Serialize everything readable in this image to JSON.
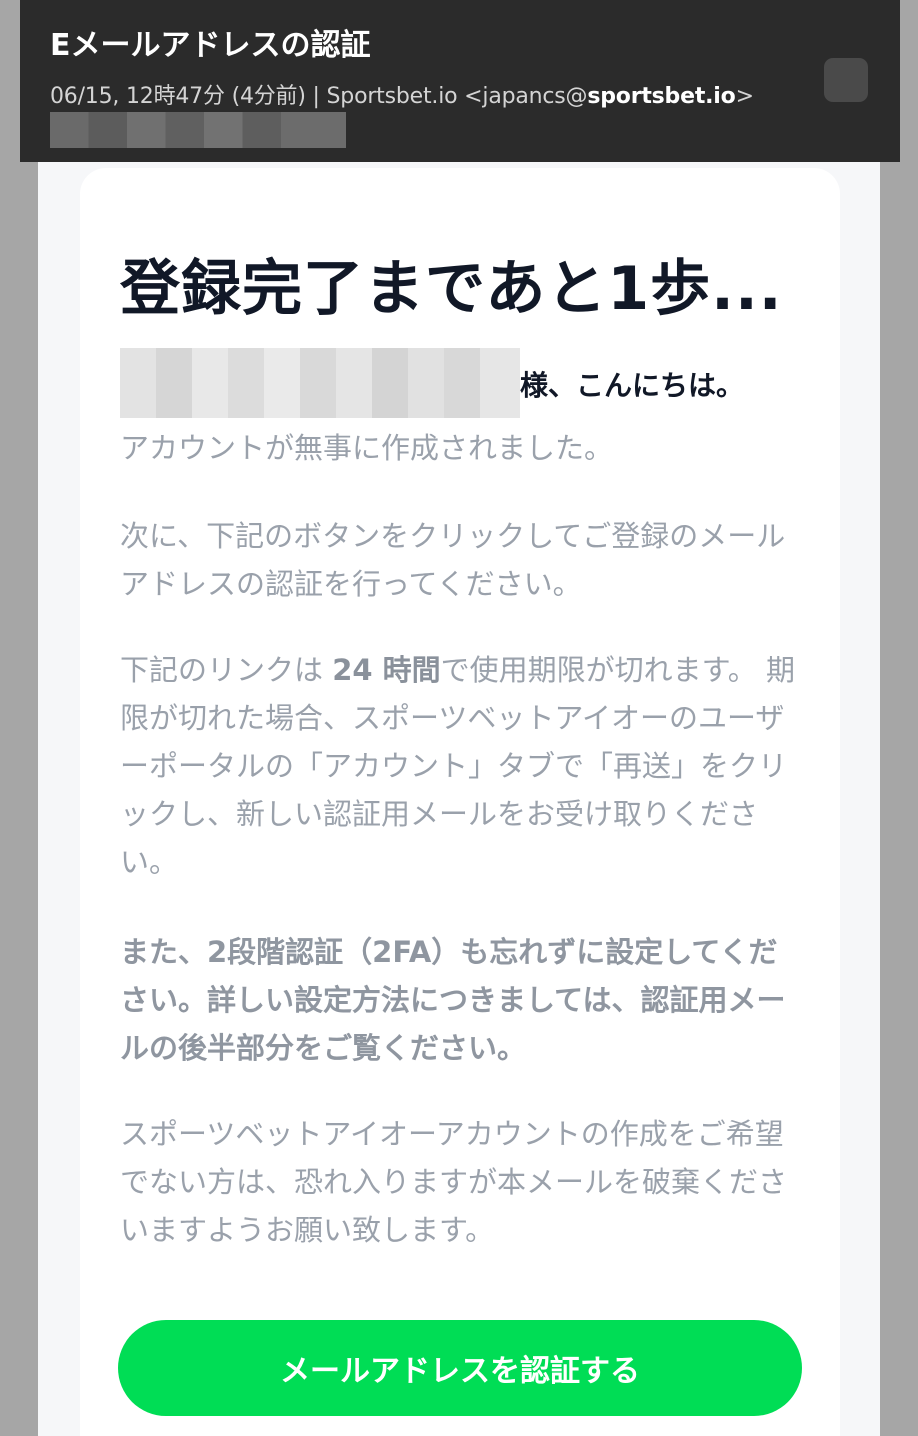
{
  "header": {
    "subject": "Eメールアドレスの認証",
    "date": "06/15, 12時47分 (4分前)",
    "separator": " | ",
    "sender_name": "Sportsbet.io",
    "sender_email_prefix": " <japancs@",
    "sender_email_domain": "sportsbet.io",
    "sender_email_suffix": ">"
  },
  "email": {
    "headline": "登録完了まであと1歩...",
    "greeting_suffix": "様、こんにちは。",
    "p1": "アカウントが無事に作成されました。",
    "p2": "次に、下記のボタンをクリックしてご登録のメールアドレスの認証を行ってください。",
    "p3_before": "下記のリンクは ",
    "p3_strong": "24 時間",
    "p3_after": "で使用期限が切れます。 期限が切れた場合、スポーツベットアイオーのユーザーポータルの「アカウント」タブで「再送」をクリックし、新しい認証用メールをお受け取りください。",
    "p4": "また、2段階認証（2FA）も忘れずに設定してください。詳しい設定方法につきましては、認証用メールの後半部分をご覧ください。",
    "p5": "スポーツベットアイオーアカウントの作成をご希望でない方は、恐れ入りますが本メールを破棄くださいますようお願い致します。",
    "button_label": "メールアドレスを認証する"
  },
  "colors": {
    "header_bg": "#2b2b2b",
    "button": "#00dd55",
    "headline": "#111827",
    "body_text": "#9aa1ab"
  }
}
